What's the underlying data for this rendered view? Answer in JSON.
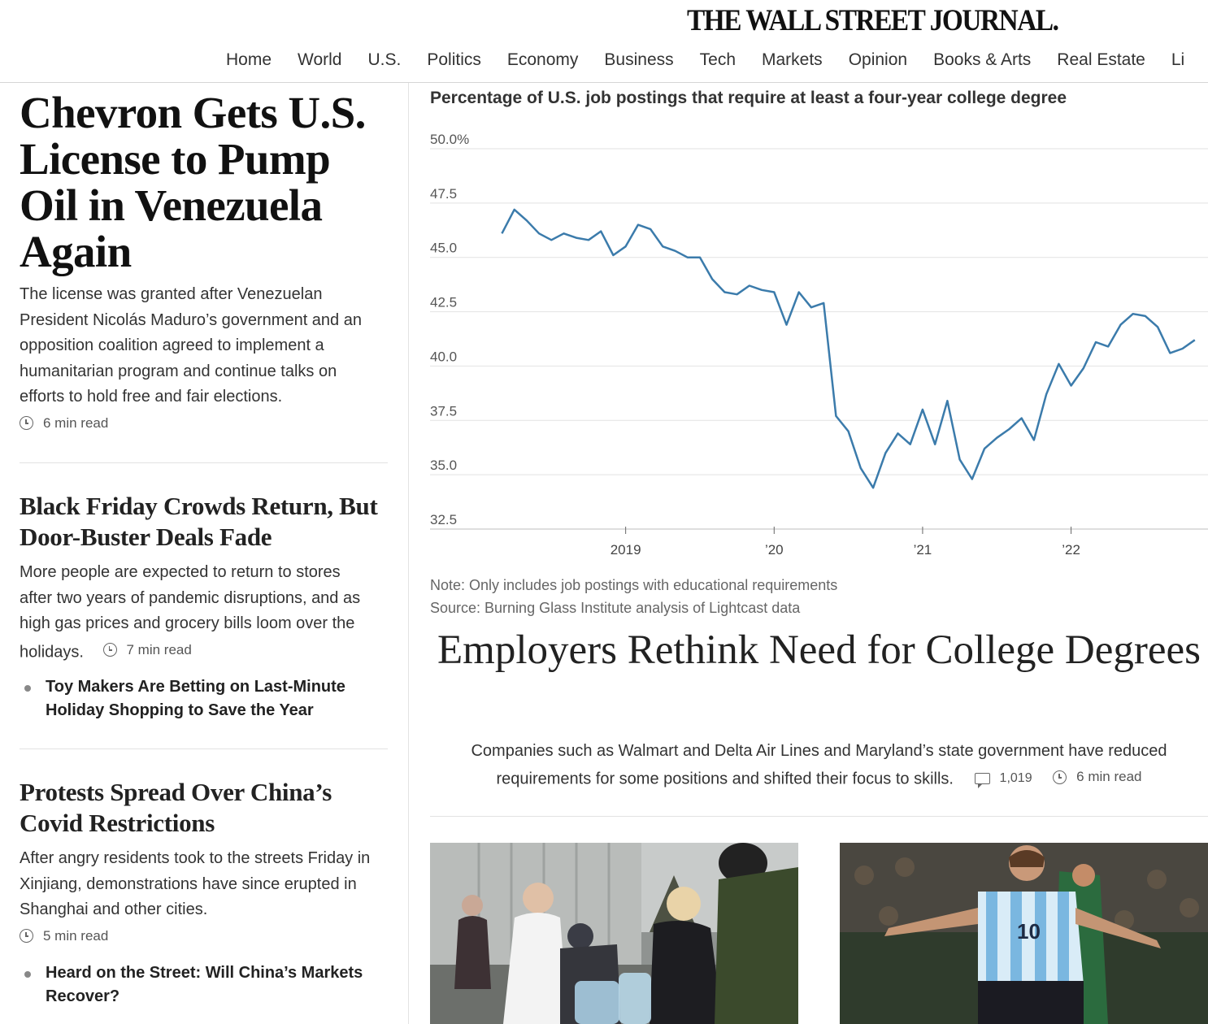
{
  "masthead": {
    "logo": "THE WALL STREET JOURNAL.",
    "nav": [
      "Home",
      "World",
      "U.S.",
      "Politics",
      "Economy",
      "Business",
      "Tech",
      "Markets",
      "Opinion",
      "Books & Arts",
      "Real Estate",
      "Li"
    ]
  },
  "lead_story": {
    "headline": "Chevron Gets U.S. License to Pump Oil in Venezuela Again",
    "summary": "The license was granted after Venezuelan President Nicolás Maduro’s government and an opposition coalition agreed to implement a humanitarian program and continue talks on efforts to hold free and fair elections.",
    "read_time": "6 min read"
  },
  "story2": {
    "headline": "Black Friday Crowds Return, But Door-Buster Deals Fade",
    "summary": "More people are expected to return to stores after two years of pandemic disruptions, and as high gas prices and grocery bills loom over the holidays.",
    "read_time": "7 min read",
    "related": "Toy Makers Are Betting on Last-Minute Holiday Shopping to Save the Year"
  },
  "story3": {
    "headline": "Protests Spread Over China’s Covid Restrictions",
    "summary": "After angry residents took to the streets Friday in Xinjiang, demonstrations have since erupted in Shanghai and other cities.",
    "read_time": "5 min read",
    "related": "Heard on the Street: Will China’s Markets Recover?"
  },
  "chart_data": {
    "type": "line",
    "title": "Percentage of U.S. job postings that require at least a four-year college degree",
    "ylim": [
      32.5,
      50
    ],
    "y_ticks": [
      "50.0%",
      "47.5",
      "45.0",
      "42.5",
      "40.0",
      "37.5",
      "35.0",
      "32.5"
    ],
    "x_ticks": [
      "2019",
      "’20",
      "’21",
      "’22"
    ],
    "x_range": [
      "2018-03",
      "2022-11"
    ],
    "color": "#3b7bab",
    "series": [
      {
        "x": [
          "2018-03",
          "2018-04",
          "2018-05",
          "2018-06",
          "2018-07",
          "2018-08",
          "2018-09",
          "2018-10",
          "2018-11",
          "2018-12",
          "2019-01",
          "2019-02",
          "2019-03",
          "2019-04",
          "2019-05",
          "2019-06",
          "2019-07",
          "2019-08",
          "2019-09",
          "2019-10",
          "2019-11",
          "2019-12",
          "2020-01",
          "2020-02",
          "2020-03",
          "2020-04",
          "2020-05",
          "2020-06",
          "2020-07",
          "2020-08",
          "2020-09",
          "2020-10",
          "2020-11",
          "2020-12",
          "2021-01",
          "2021-02",
          "2021-03",
          "2021-04",
          "2021-05",
          "2021-06",
          "2021-07",
          "2021-08",
          "2021-09",
          "2021-10",
          "2021-11",
          "2021-12",
          "2022-01",
          "2022-02",
          "2022-03",
          "2022-04",
          "2022-05",
          "2022-06",
          "2022-07",
          "2022-08",
          "2022-09",
          "2022-10",
          "2022-11"
        ],
        "values": [
          46.1,
          47.2,
          46.7,
          46.1,
          45.8,
          46.1,
          45.9,
          45.8,
          46.2,
          45.1,
          45.5,
          46.5,
          46.3,
          45.5,
          45.3,
          45.0,
          45.0,
          44.0,
          43.4,
          43.3,
          43.7,
          43.5,
          43.4,
          41.9,
          43.4,
          42.7,
          42.9,
          37.7,
          37.0,
          35.3,
          34.4,
          36.0,
          36.9,
          36.4,
          38.0,
          36.4,
          38.4,
          35.7,
          34.8,
          36.2,
          36.7,
          37.1,
          37.6,
          36.6,
          38.7,
          40.1,
          39.1,
          39.9,
          41.1,
          40.9,
          41.9,
          42.4,
          42.3,
          41.8,
          40.6,
          40.8,
          41.2
        ]
      }
    ],
    "note": "Note: Only includes job postings with educational requirements",
    "source": "Source: Burning Glass Institute analysis of Lightcast data"
  },
  "feature": {
    "headline": "Employers Rethink Need for College Degrees",
    "summary": "Companies such as Walmart and Delta Air Lines and Maryland’s state government have reduced requirements for some positions and shifted their focus to skills.",
    "comments": "1,019",
    "read_time": "6 min read"
  }
}
